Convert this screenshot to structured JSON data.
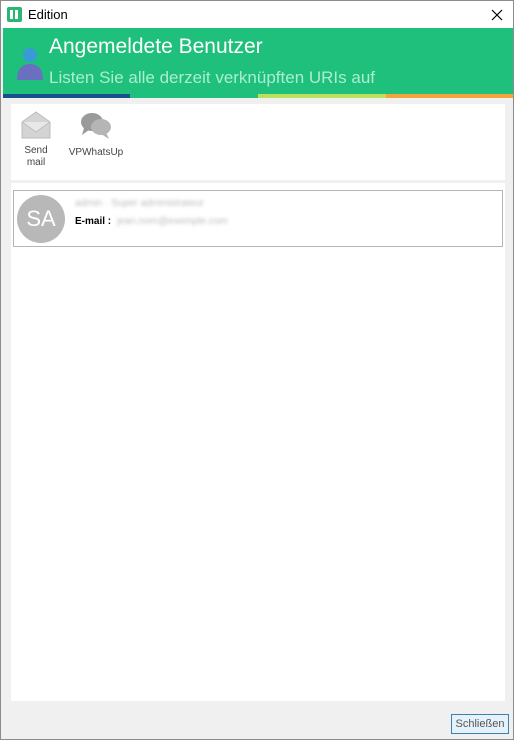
{
  "window": {
    "title": "Edition"
  },
  "header": {
    "title": "Angemeldete Benutzer",
    "subtitle": "Listen Sie alle derzeit verknüpften URIs auf",
    "stripe_colors": [
      "#1a4f8f",
      "#1fbf7c",
      "#b8e05a",
      "#f2a53a"
    ]
  },
  "toolbar": {
    "items": [
      {
        "label_line1": "Send",
        "label_line2": "mail",
        "icon": "envelope-icon"
      },
      {
        "label_line1": "VPWhatsUp",
        "label_line2": "",
        "icon": "chat-bubbles-icon"
      }
    ]
  },
  "users": [
    {
      "initials": "SA",
      "name": "admin · Super administrateur",
      "email_label": "E-mail :",
      "email": "jean.nom@exemple.com"
    }
  ],
  "footer": {
    "close_label": "Schließen"
  },
  "colors": {
    "accent": "#1fbf7c",
    "avatar": "#b8b8b8"
  }
}
